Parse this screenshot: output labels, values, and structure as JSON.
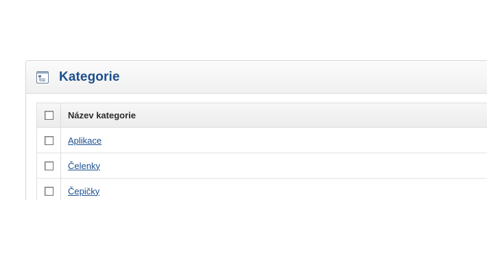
{
  "panel": {
    "title": "Kategorie",
    "icon": "category-tree-icon"
  },
  "table": {
    "header": {
      "name_label": "Název kategorie"
    },
    "rows": [
      {
        "name": "Aplikace"
      },
      {
        "name": "Čelenky"
      },
      {
        "name": "Čepičky"
      }
    ]
  },
  "colors": {
    "title": "#1b4f8c",
    "link": "#1a4f8f"
  }
}
